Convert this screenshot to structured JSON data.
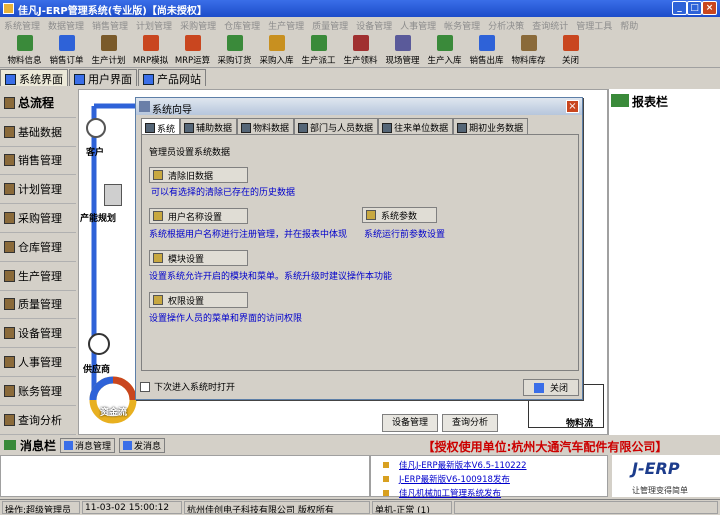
{
  "window": {
    "title": "佳凡J-ERP管理系统(专业版)【尚未授权】"
  },
  "menu": [
    "系统管理",
    "数据管理",
    "销售管理",
    "计划管理",
    "采购管理",
    "仓库管理",
    "生产管理",
    "质量管理",
    "设备管理",
    "人事管理",
    "帐务管理",
    "分析决策",
    "查询统计",
    "管理工具",
    "帮助"
  ],
  "toolbar": [
    {
      "label": "物料信息",
      "icon": "material-icon",
      "color": "#3a8a3a"
    },
    {
      "label": "销售订单",
      "icon": "sales-order-icon",
      "color": "#2e62d8"
    },
    {
      "label": "生产计划",
      "icon": "production-plan-icon",
      "color": "#7a5a2a"
    },
    {
      "label": "MRP模拟",
      "icon": "mrp-sim-icon",
      "color": "#c9461f"
    },
    {
      "label": "MRP运算",
      "icon": "mrp-calc-icon",
      "color": "#c9461f"
    },
    {
      "label": "采购订货",
      "icon": "purchase-icon",
      "color": "#3a8a3a"
    },
    {
      "label": "采购入库",
      "icon": "purchase-in-icon",
      "color": "#c89020"
    },
    {
      "label": "生产派工",
      "icon": "dispatch-icon",
      "color": "#3a8a3a"
    },
    {
      "label": "生产领料",
      "icon": "pick-icon",
      "color": "#a03030"
    },
    {
      "label": "现场管理",
      "icon": "site-icon",
      "color": "#5a5a9a"
    },
    {
      "label": "生产入库",
      "icon": "prod-in-icon",
      "color": "#3a8a3a"
    },
    {
      "label": "销售出库",
      "icon": "sales-out-icon",
      "color": "#2e62d8"
    },
    {
      "label": "物料库存",
      "icon": "stock-icon",
      "color": "#8a6a3a"
    },
    {
      "label": "关闭",
      "icon": "exit-icon",
      "color": "#c9461f"
    }
  ],
  "tabs": [
    "系统界面",
    "用户界面",
    "产品网站"
  ],
  "sidebar": [
    "总流程",
    "基础数据",
    "销售管理",
    "计划管理",
    "采购管理",
    "仓库管理",
    "生产管理",
    "质量管理",
    "设备管理",
    "人事管理",
    "账务管理",
    "查询分析"
  ],
  "flow": {
    "customer": "客户",
    "capacity": "产能规划",
    "supplier": "供应商",
    "circle": "资金流",
    "info_flow": "物料流"
  },
  "right_panel": {
    "title": "报表栏"
  },
  "dialog": {
    "title": "系统向导",
    "tabs": [
      "系统",
      "辅助数据",
      "物料数据",
      "部门与人员数据",
      "往来单位数据",
      "期初业务数据"
    ],
    "heading": "管理员设置系统数据",
    "buttons": [
      {
        "label": "清除旧数据",
        "desc": "可以有选择的清除已存在的历史数据"
      },
      {
        "label": "用户名称设置",
        "desc": "系统根据用户名称进行注册管理，并在报表中体现"
      },
      {
        "label": "系统参数",
        "desc": "系统运行前参数设置"
      },
      {
        "label": "模块设置",
        "desc": "设置系统允许开启的模块和菜单。系统升级时建议操作本功能"
      },
      {
        "label": "权限设置",
        "desc": "设置操作人员的菜单和界面的访问权限"
      }
    ],
    "checkbox_label": "下次进入系统时打开",
    "close_label": "关闭"
  },
  "main_buttons": [
    "设备管理",
    "查询分析"
  ],
  "msgbar": {
    "title": "消息栏",
    "tabs": [
      "消息管理",
      "发消息"
    ]
  },
  "auth": "【授权使用单位:杭州大通汽车配件有限公司】",
  "news": [
    "佳凡J-ERP最新版本V6.5-110222",
    "J-ERP最新版V6-100918发布",
    "佳凡机械加工管理系统发布"
  ],
  "logo": {
    "brand": "J-ERP",
    "slogan": "让管理变得简单"
  },
  "status": [
    "操作:超级管理员",
    "11-03-02 15:00:12",
    "杭州佳创电子科技有限公司 版权所有",
    "单机-正常 (1)"
  ]
}
